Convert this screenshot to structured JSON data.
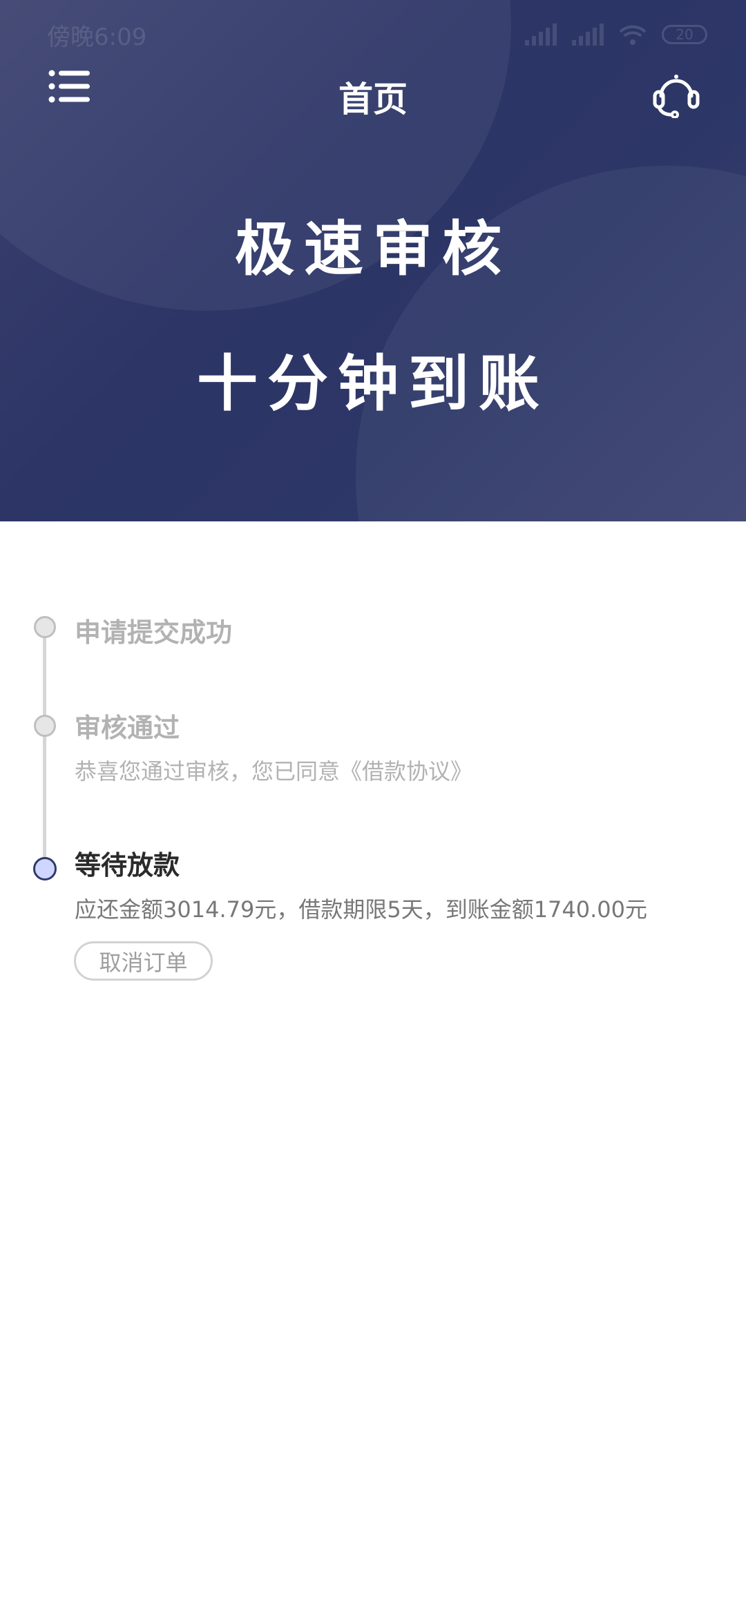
{
  "status_bar": {
    "time": "傍晚6:09",
    "battery": "20"
  },
  "header": {
    "title": "首页",
    "menu_icon": "list-menu-icon",
    "service_icon": "headset-customer-service-icon",
    "slogan_line1": "极速审核",
    "slogan_line2": "十分钟到账",
    "colors": {
      "bg": "#2c3566",
      "text": "#ffffff"
    }
  },
  "timeline": {
    "steps": [
      {
        "title": "申请提交成功",
        "desc": "",
        "state": "done"
      },
      {
        "title": "审核通过",
        "desc": "恭喜您通过审核，您已同意《借款协议》",
        "state": "done"
      },
      {
        "title": "等待放款",
        "desc": "应还金额3014.79元，借款期限5天，到账金额1740.00元",
        "state": "active"
      }
    ],
    "cancel_label": "取消订单",
    "colors": {
      "active_node": "#cfd6ff",
      "active_border": "#2f3a6b",
      "done_node": "#e6e6e6"
    }
  }
}
